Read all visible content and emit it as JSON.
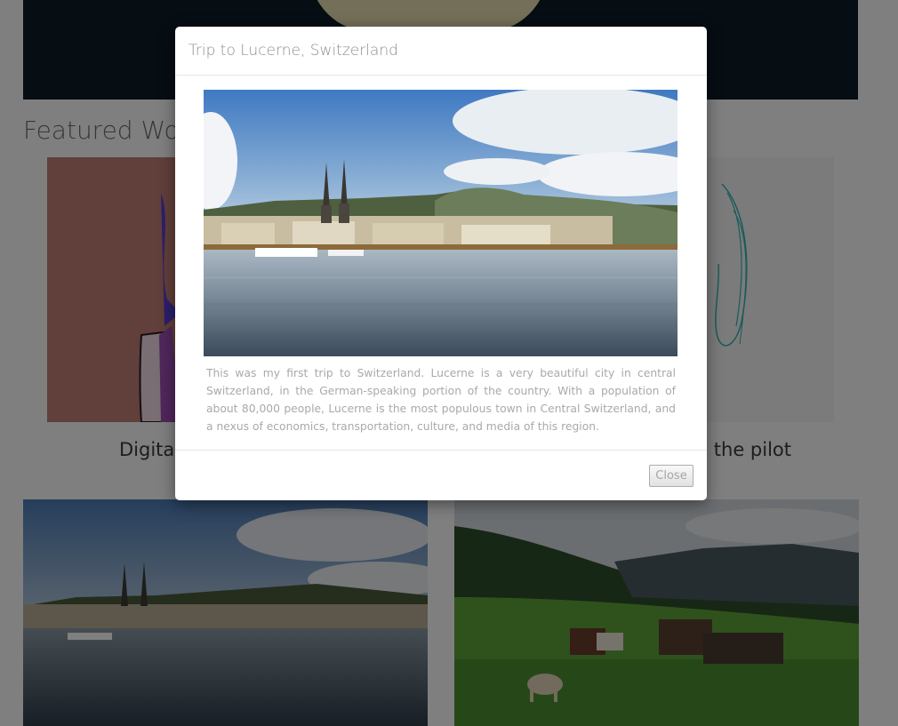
{
  "section": {
    "title": "Featured Wo"
  },
  "cards": [
    {
      "caption": "Digita"
    },
    {
      "caption": "y the pilot"
    }
  ],
  "modal": {
    "title": "Trip to Lucerne, Switzerland",
    "description": "This was my first trip to Switzerland. Lucerne is a very beautiful city in central Switzerland, in the German-speaking portion of the country. With a population of about 80,000 people, Lucerne is the most populous town in Central Switzerland, and a nexus of economics, transportation, culture, and media of this region.",
    "close_label": "Close"
  },
  "colors": {
    "overlay": "#000000",
    "modal_background": "#ffffff",
    "hero_background": "#0c1a26"
  }
}
